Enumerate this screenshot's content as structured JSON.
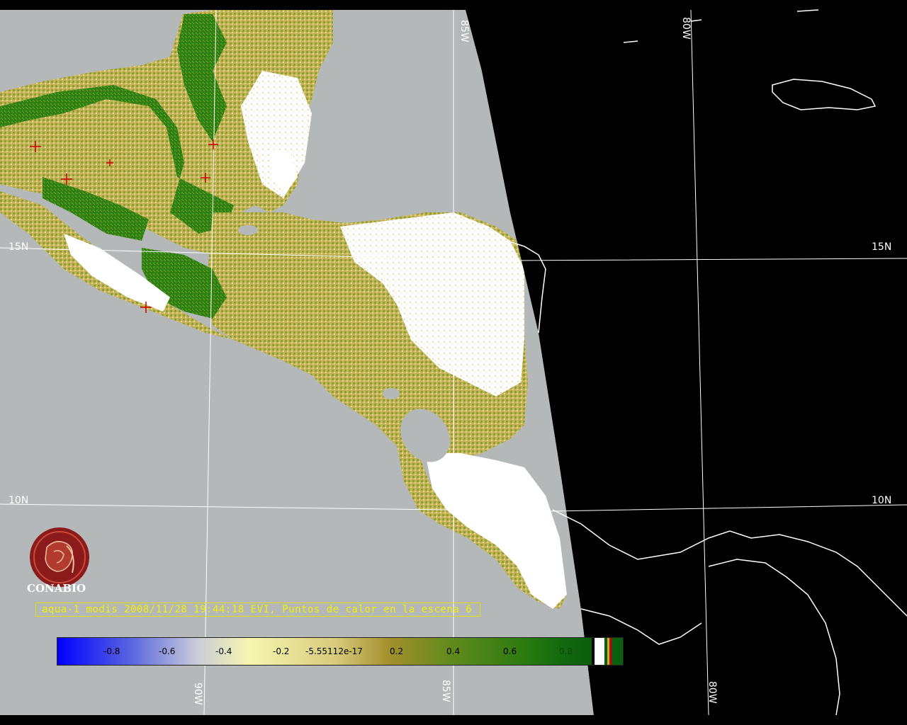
{
  "caption": "aqua-1 modis 2008/11/28 19:44:18 EVI, Puntos de calor en la escena 6",
  "logo_text": "CONABIO",
  "grid_labels": {
    "lat_15_left": "15N",
    "lat_15_right": "15N",
    "lat_10_left": "10N",
    "lat_10_right": "10N",
    "lon_85_top": "85W",
    "lon_80_top": "80W",
    "lon_90_bottom": "90W",
    "lon_85_bottom": "85W",
    "lon_80_bottom": "80W"
  },
  "colorbar": {
    "ticks": [
      "-0.8",
      "-0.6",
      "-0.4",
      "-0.2",
      "-5.55112e-17",
      "0.2",
      "0.4",
      "0.6",
      "0.8"
    ],
    "colors": {
      "low": "#0000ff",
      "mid_low": "#f4f4b0",
      "mid": "#a89a3c",
      "high": "#0b5e0b"
    }
  },
  "colors": {
    "ocean_day": "#b5b8b8",
    "night": "#000000",
    "land_tan": "#c8b45a",
    "vegetation_green": "#3a8a18",
    "cloud": "#ffffff",
    "hotspot": "#cc0000"
  },
  "hotspots_count": 6
}
